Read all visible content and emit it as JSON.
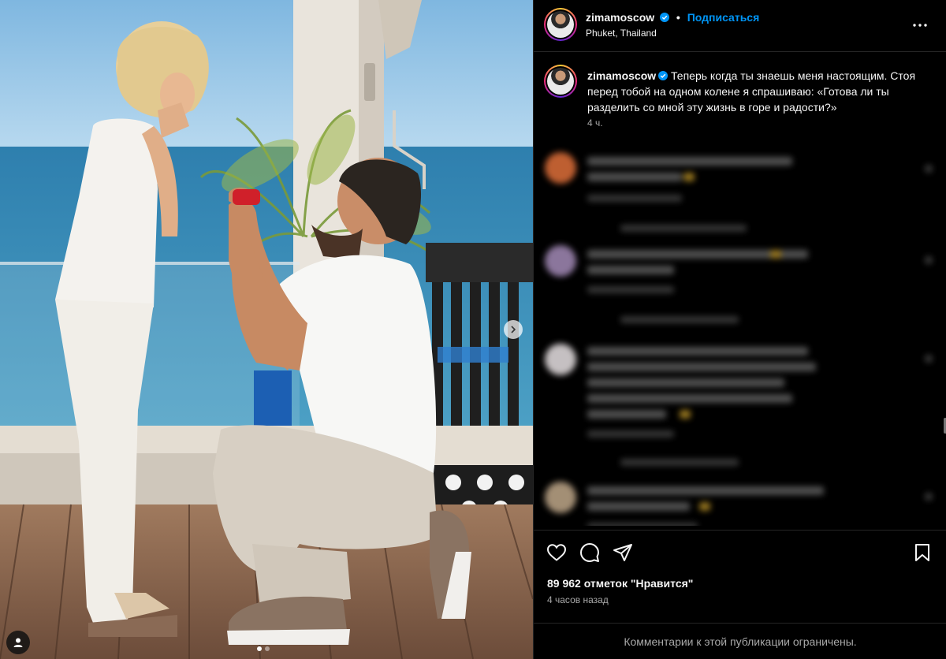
{
  "post": {
    "username": "zimamoscow",
    "verified": true,
    "follow_label": "Подписаться",
    "separator": "•",
    "location": "Phuket, Thailand"
  },
  "caption": {
    "username": "zimamoscow",
    "text": "Теперь когда ты знаешь меня настоящим. Стоя перед тобой на одном колене я спрашиваю: «Готова ли ты разделить со мной эту жизнь в горе и радости?»",
    "time": "4 ч."
  },
  "comments_partial_meta": "2 ч.  \"Нравится\": 464",
  "likes_text": "89 962 отметок \"Нравится\"",
  "posted_ago": "4 часов назад",
  "comments_restricted": "Комментарии к этой публикации ограничены.",
  "carousel": {
    "current": 1,
    "total": 2
  },
  "icons": {
    "more": "more-options-icon",
    "like": "heart-icon",
    "comment": "comment-icon",
    "share": "share-icon",
    "save": "bookmark-icon",
    "next": "chevron-right-icon",
    "tag": "user-tag-icon",
    "verified": "verified-badge-icon"
  },
  "colors": {
    "background": "#000000",
    "link": "#0095f6",
    "text": "#f5f5f5",
    "secondary": "#a8a8a8",
    "divider": "#262626"
  }
}
